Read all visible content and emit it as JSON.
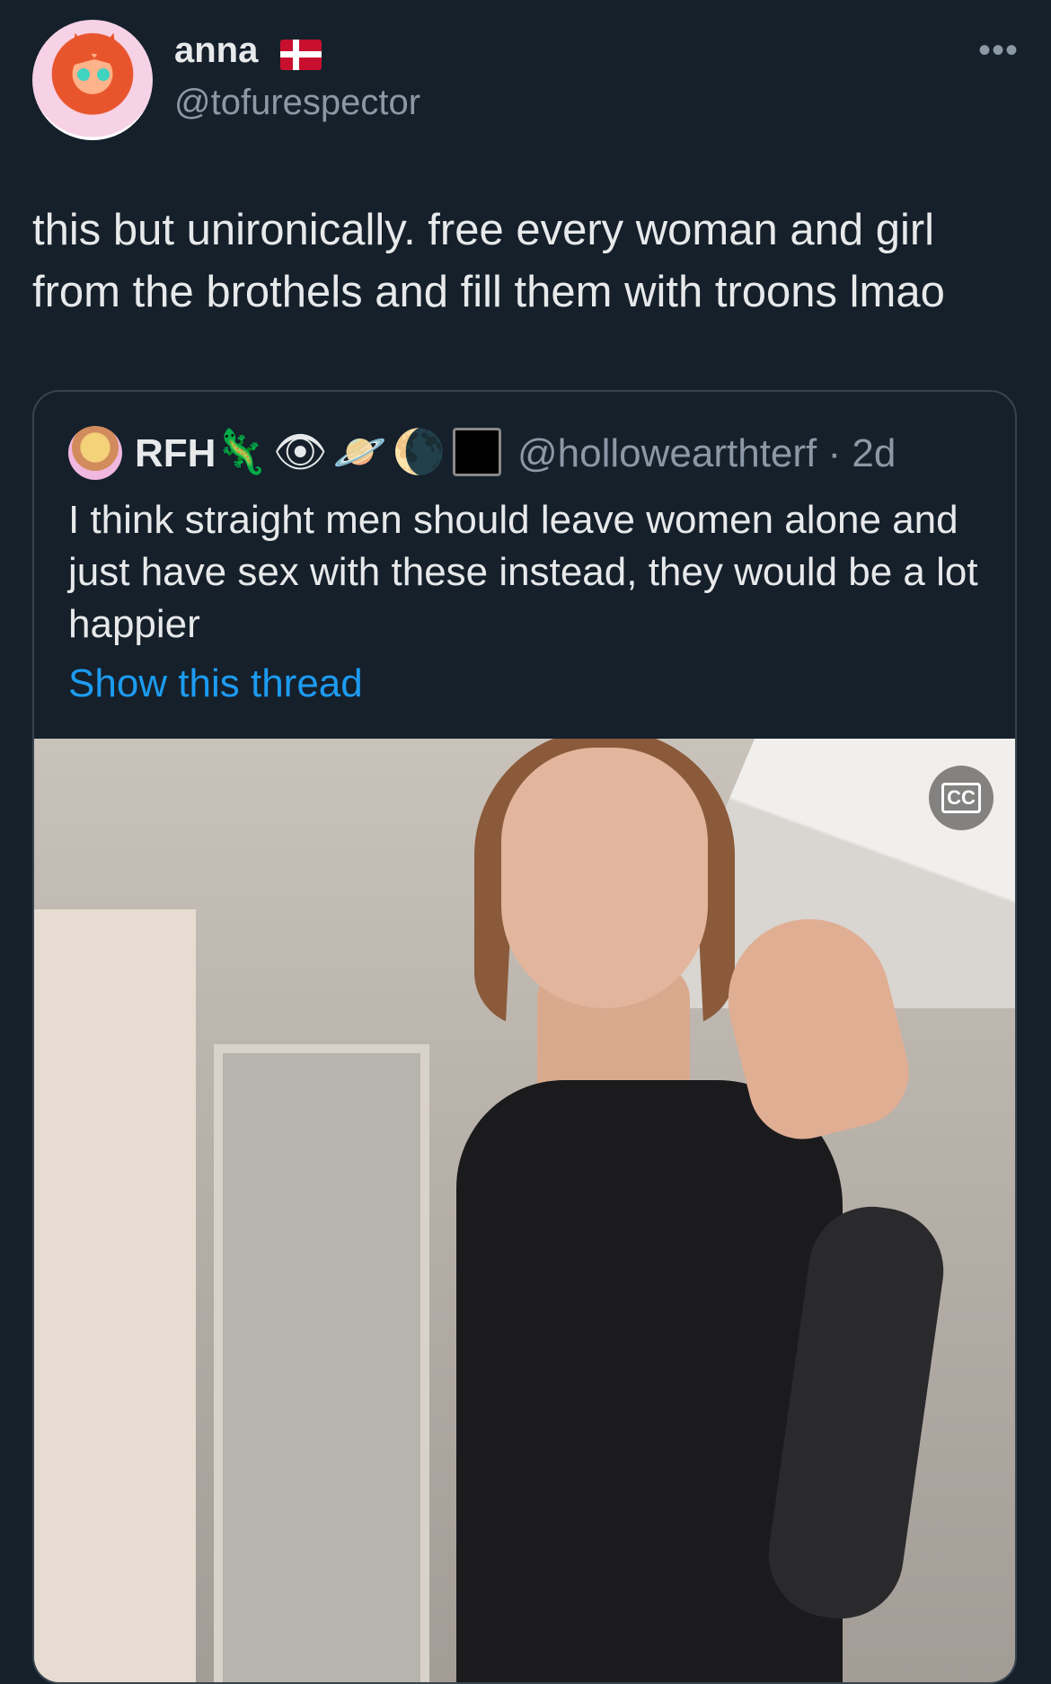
{
  "tweet": {
    "author": {
      "display_name": "anna",
      "flag": "🇩🇰",
      "handle": "@tofurespector"
    },
    "more_label": "•••",
    "text": "this but unironically. free every woman and girl from the brothels and fill them with troons lmao"
  },
  "quoted_tweet": {
    "author": {
      "display_name": "RFH",
      "emojis": "🦎👁🪐🌘",
      "handle_time": "@hollowearthterf · 2d"
    },
    "text": "I think straight men should leave women alone and just have sex with these instead, they would be a lot happier",
    "show_thread_label": "Show this thread",
    "media": {
      "captions_icon": "closed-captions-icon",
      "captions_label": "CC"
    }
  },
  "colors": {
    "background": "#15202b",
    "primary_text": "#e7e9ea",
    "secondary_text": "#8b98a5",
    "link": "#1d9bf0",
    "border": "#38444d"
  }
}
